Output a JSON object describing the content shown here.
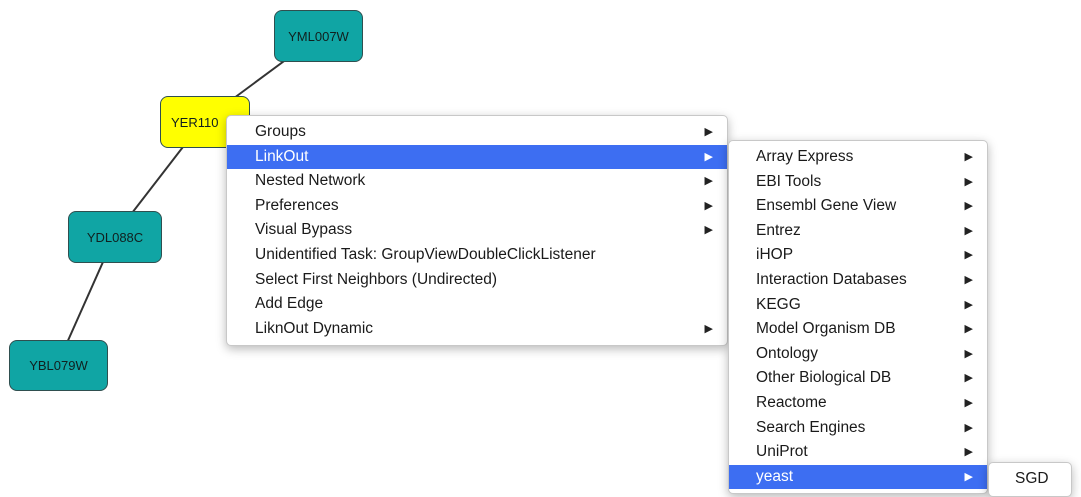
{
  "network": {
    "nodes": [
      {
        "id": "YML007W",
        "color": "#10a5a4"
      },
      {
        "id": "YER110",
        "color": "#ffff00",
        "selected": true
      },
      {
        "id": "YDL088C",
        "color": "#10a5a4"
      },
      {
        "id": "YBL079W",
        "color": "#10a5a4"
      }
    ]
  },
  "context_menu": {
    "items": [
      {
        "label": "Groups",
        "submenu": true
      },
      {
        "label": "LinkOut",
        "submenu": true,
        "active": true
      },
      {
        "label": "Nested Network",
        "submenu": true
      },
      {
        "label": "Preferences",
        "submenu": true
      },
      {
        "label": "Visual Bypass",
        "submenu": true
      },
      {
        "label": "Unidentified Task: GroupViewDoubleClickListener",
        "submenu": false
      },
      {
        "label": "Select First Neighbors (Undirected)",
        "submenu": false
      },
      {
        "label": "Add Edge",
        "submenu": false
      },
      {
        "label": "LiknOut Dynamic",
        "submenu": true
      }
    ]
  },
  "linkout_menu": {
    "items": [
      {
        "label": "Array Express",
        "submenu": true
      },
      {
        "label": "EBI Tools",
        "submenu": true
      },
      {
        "label": "Ensembl Gene View",
        "submenu": true
      },
      {
        "label": "Entrez",
        "submenu": true
      },
      {
        "label": "iHOP",
        "submenu": true
      },
      {
        "label": "Interaction Databases",
        "submenu": true
      },
      {
        "label": "KEGG",
        "submenu": true
      },
      {
        "label": "Model Organism DB",
        "submenu": true
      },
      {
        "label": "Ontology",
        "submenu": true
      },
      {
        "label": "Other Biological DB",
        "submenu": true
      },
      {
        "label": "Reactome",
        "submenu": true
      },
      {
        "label": "Search Engines",
        "submenu": true
      },
      {
        "label": "UniProt",
        "submenu": true
      },
      {
        "label": "yeast",
        "submenu": true,
        "active": true
      }
    ]
  },
  "yeast_menu": {
    "items": [
      {
        "label": "SGD"
      }
    ]
  },
  "colors": {
    "menu_highlight": "#3d6ef2",
    "node_teal": "#10a5a4",
    "node_selected": "#ffff00",
    "edge": "#333333"
  },
  "icons": {
    "submenu_arrow": "▶"
  }
}
